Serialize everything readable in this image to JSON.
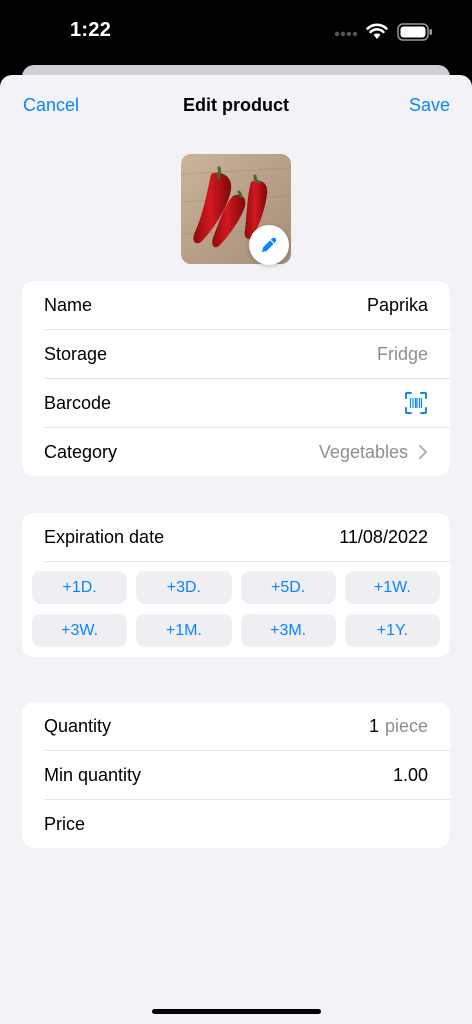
{
  "status_bar": {
    "time": "1:22"
  },
  "nav": {
    "cancel": "Cancel",
    "title": "Edit product",
    "save": "Save"
  },
  "product": {
    "photo_icon": "pencil-icon",
    "fields": {
      "name_label": "Name",
      "name_value": "Paprika",
      "storage_label": "Storage",
      "storage_placeholder": "Fridge",
      "barcode_label": "Barcode",
      "barcode_icon": "barcode-scan-icon",
      "category_label": "Category",
      "category_value": "Vegetables"
    }
  },
  "expiration": {
    "label": "Expiration date",
    "value": "11/08/2022",
    "quick_buttons": [
      "+1D.",
      "+3D.",
      "+5D.",
      "+1W.",
      "+3W.",
      "+1M.",
      "+3M.",
      "+1Y."
    ]
  },
  "quantity_section": {
    "quantity_label": "Quantity",
    "quantity_value": "1",
    "quantity_unit": "piece",
    "min_quantity_label": "Min quantity",
    "min_quantity_value": "1.00",
    "price_label": "Price"
  },
  "colors": {
    "accent": "#0a84ff",
    "background": "#f2f2f7",
    "secondary_text": "#8e8e93"
  }
}
